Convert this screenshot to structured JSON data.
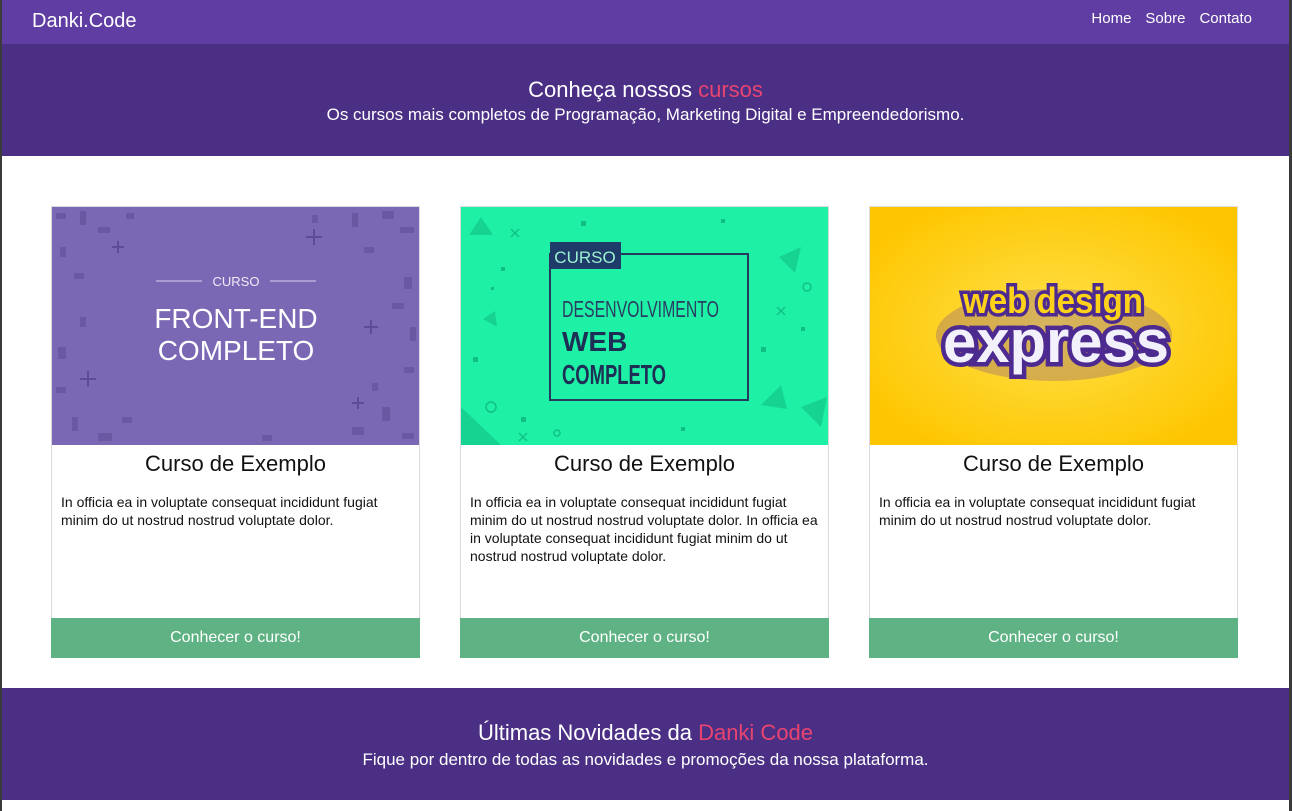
{
  "header": {
    "logo": "Danki.Code",
    "nav": [
      "Home",
      "Sobre",
      "Contato"
    ]
  },
  "hero": {
    "title_prefix": "Conheça nossos ",
    "title_accent": "cursos",
    "subtitle": "Os cursos mais completos de Programação, Marketing Digital e Empreendedorismo."
  },
  "courses": [
    {
      "thumb_label": "CURSO",
      "thumb_line1": "FRONT-END",
      "thumb_line2": "COMPLETO",
      "title": "Curso de Exemplo",
      "description": "In officia ea in voluptate consequat incididunt fugiat minim do ut nostrud nostrud voluptate dolor.",
      "button": "Conhecer o curso!"
    },
    {
      "thumb_label": "CURSO",
      "thumb_line1": "DESENVOLVIMENTO",
      "thumb_line2": "WEB",
      "thumb_line3": "COMPLETO",
      "title": "Curso de Exemplo",
      "description": "In officia ea in voluptate consequat incididunt fugiat minim do ut nostrud nostrud voluptate dolor. In officia ea in voluptate consequat incididunt fugiat minim do ut nostrud nostrud voluptate dolor.",
      "button": "Conhecer o curso!"
    },
    {
      "thumb_line1": "web design",
      "thumb_line2": "express",
      "title": "Curso de Exemplo",
      "description": "In officia ea in voluptate consequat incididunt fugiat minim do ut nostrud nostrud voluptate dolor.",
      "button": "Conhecer o curso!"
    }
  ],
  "news": {
    "title_prefix": "Últimas Novidades da ",
    "title_accent": "Danki Code",
    "subtitle": "Fique por dentro de todas as novidades e promoções da nossa plataforma."
  },
  "colors": {
    "nav_bg": "#5f3da3",
    "band_bg": "#4a2f85",
    "accent": "#e8446e",
    "button": "#5fb283"
  }
}
